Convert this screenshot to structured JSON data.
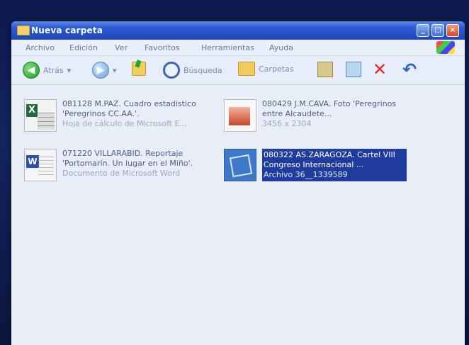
{
  "window": {
    "title": "Nueva carpeta",
    "buttons": [
      "_",
      "□",
      "×"
    ]
  },
  "menu": [
    "Archivo",
    "Edición",
    "Ver",
    "Favoritos",
    "Herramientas",
    "Ayuda"
  ],
  "toolbar": {
    "back": "Atrás",
    "search": "Búsqueda",
    "folders": "Carpetas"
  },
  "files": [
    {
      "name": "081128 M.PAZ. Cuadro estadistico 'Peregrinos CC.AA.'.",
      "type": "Hoja de cálculo de Microsoft E...",
      "icon": "excel-icon"
    },
    {
      "name": "080429 J.M.CAVA. Foto 'Peregrinos entre Alcaudete...",
      "type": "3456 x 2304",
      "icon": "image-icon"
    },
    {
      "name": "071220 VILLARABID. Reportaje 'Portomarín. Un lugar en el Miño'.",
      "type": "Documento de Microsoft Word",
      "icon": "word-icon"
    },
    {
      "name": "080322 AS.ZARAGOZA. Cartel VIII Congreso Internacional ...",
      "type": "Archivo 36__1339589",
      "icon": "poster-icon"
    }
  ],
  "colors": {
    "titlebar": "#2c5bd4",
    "selection": "#1f3d9e",
    "background": "#e8edf8"
  }
}
